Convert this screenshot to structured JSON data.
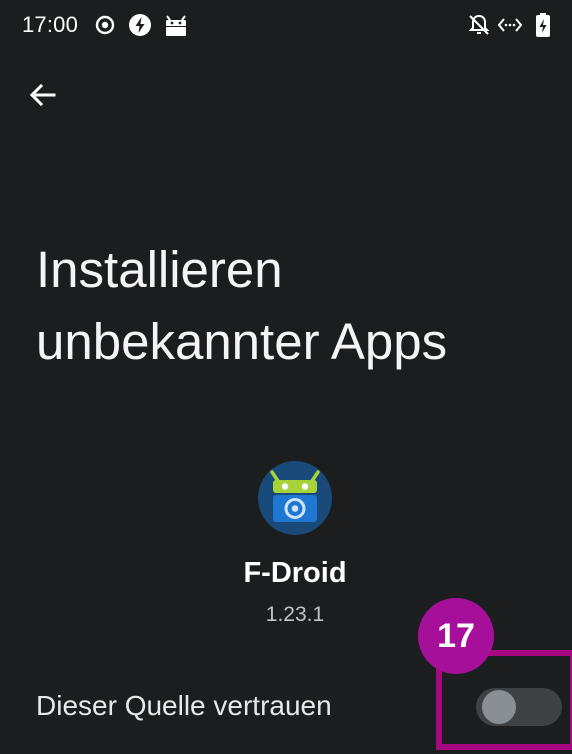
{
  "status_bar": {
    "time": "17:00",
    "icons_left": [
      "record-icon",
      "flash-icon",
      "fdroid-notification-icon"
    ],
    "icons_right": [
      "notifications-off-icon",
      "data-saver-icon",
      "battery-charging-icon"
    ]
  },
  "toolbar": {
    "back_icon": "arrow-back-icon"
  },
  "page": {
    "title": "Installieren unbekannter Apps"
  },
  "app": {
    "name": "F-Droid",
    "version": "1.23.1",
    "icon": "fdroid-app-icon"
  },
  "setting": {
    "label": "Dieser Quelle vertrauen",
    "enabled": false
  },
  "annotation": {
    "number": "17",
    "color": "#a5097f"
  },
  "colors": {
    "background": "#1b1d1f",
    "switch_track": "#3e4245",
    "switch_thumb": "#8a8f93"
  }
}
